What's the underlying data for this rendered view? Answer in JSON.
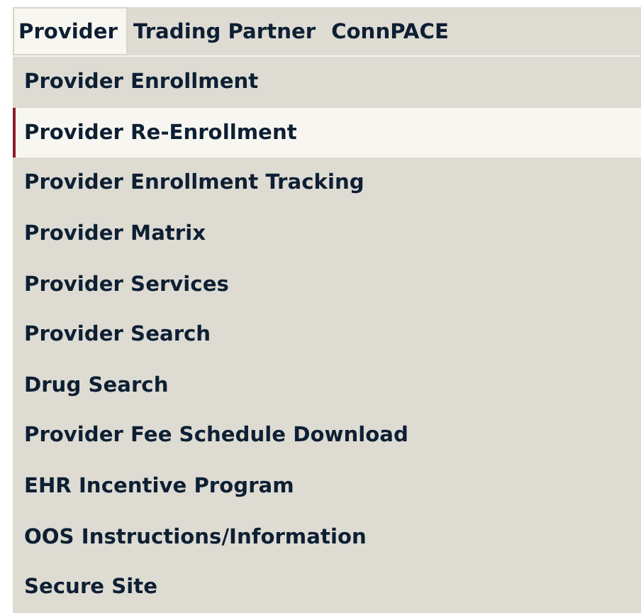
{
  "menu_bar": [
    {
      "label": "Provider",
      "selected": true
    },
    {
      "label": "Trading Partner",
      "selected": false
    },
    {
      "label": "ConnPACE",
      "selected": false
    }
  ],
  "dropdown": {
    "items": [
      {
        "label": "Provider Enrollment",
        "selected": false
      },
      {
        "label": "Provider Re-Enrollment",
        "selected": true
      },
      {
        "label": "Provider Enrollment Tracking",
        "selected": false
      },
      {
        "label": "Provider Matrix",
        "selected": false
      },
      {
        "label": "Provider Services",
        "selected": false
      },
      {
        "label": "Provider Search",
        "selected": false
      },
      {
        "label": "Drug Search",
        "selected": false
      },
      {
        "label": "Provider Fee Schedule Download",
        "selected": false
      },
      {
        "label": "EHR Incentive Program",
        "selected": false
      },
      {
        "label": "OOS Instructions/Information",
        "selected": false
      },
      {
        "label": "Secure Site",
        "selected": false
      }
    ]
  }
}
